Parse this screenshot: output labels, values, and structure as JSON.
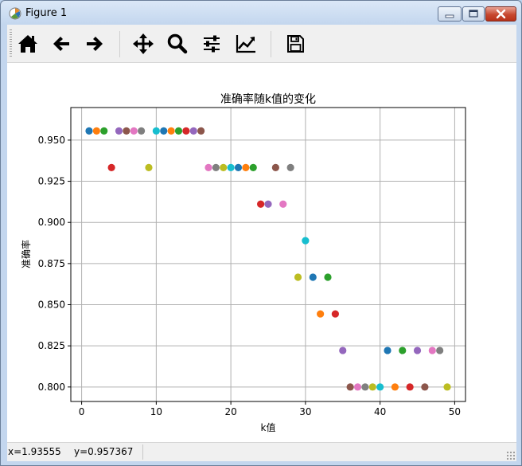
{
  "window": {
    "title": "Figure 1"
  },
  "toolbar": {
    "buttons": [
      {
        "name": "home-button",
        "icon": "home-icon"
      },
      {
        "name": "back-button",
        "icon": "arrow-left-icon"
      },
      {
        "name": "forward-button",
        "icon": "arrow-right-icon"
      },
      {
        "name": "pan-button",
        "icon": "move-arrows-icon"
      },
      {
        "name": "zoom-button",
        "icon": "magnifier-icon"
      },
      {
        "name": "configure-subplots-button",
        "icon": "sliders-icon"
      },
      {
        "name": "edit-axis-button",
        "icon": "line-chart-icon"
      },
      {
        "name": "save-button",
        "icon": "floppy-disk-icon"
      }
    ]
  },
  "status": {
    "x_readout": "x=1.93555",
    "y_readout": "y=0.957367"
  },
  "chart_data": {
    "type": "scatter",
    "title": "准确率随k值的变化",
    "xlabel": "k值",
    "ylabel": "准确率",
    "xlim": [
      -1.45,
      51.45
    ],
    "ylim": [
      0.7912,
      0.9698
    ],
    "xticks": [
      0,
      10,
      20,
      30,
      40,
      50
    ],
    "yticks": [
      0.8,
      0.825,
      0.85,
      0.875,
      0.9,
      0.925,
      0.95
    ],
    "ytick_labels": [
      "0.800",
      "0.825",
      "0.850",
      "0.875",
      "0.900",
      "0.925",
      "0.950"
    ],
    "grid": true,
    "colors": [
      "#1f77b4",
      "#ff7f0e",
      "#2ca02c",
      "#d62728",
      "#9467bd",
      "#8c564b",
      "#e377c2",
      "#7f7f7f",
      "#bcbd22",
      "#17becf"
    ],
    "x": [
      1,
      2,
      3,
      4,
      5,
      6,
      7,
      8,
      9,
      10,
      11,
      12,
      13,
      14,
      15,
      16,
      17,
      18,
      19,
      20,
      21,
      22,
      23,
      24,
      25,
      26,
      27,
      28,
      29,
      30,
      31,
      32,
      33,
      34,
      35,
      36,
      37,
      38,
      39,
      40,
      41,
      42,
      43,
      44,
      45,
      46,
      47,
      48,
      49
    ],
    "y": [
      0.9556,
      0.9556,
      0.9556,
      0.9333,
      0.9556,
      0.9556,
      0.9556,
      0.9556,
      0.9333,
      0.9556,
      0.9556,
      0.9556,
      0.9556,
      0.9556,
      0.9556,
      0.9556,
      0.9333,
      0.9333,
      0.9333,
      0.9333,
      0.9333,
      0.9333,
      0.9333,
      0.9111,
      0.9111,
      0.9333,
      0.9111,
      0.9333,
      0.8667,
      0.8889,
      0.8667,
      0.8444,
      0.8667,
      0.8444,
      0.8222,
      0.8,
      0.8,
      0.8,
      0.8,
      0.8,
      0.8222,
      0.8,
      0.8222,
      0.8,
      0.8222,
      0.8,
      0.8222,
      0.8222,
      0.8
    ]
  }
}
